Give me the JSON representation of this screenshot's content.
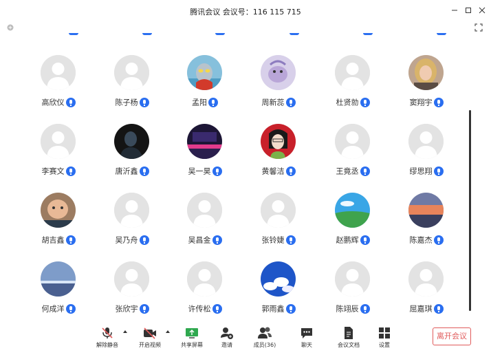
{
  "window": {
    "title": "腾讯会议 会议号：116 115 715"
  },
  "participants": [
    [
      {
        "name": "高欣仪",
        "avatar": "default"
      },
      {
        "name": "陈子杨",
        "avatar": "default"
      },
      {
        "name": "孟阳",
        "avatar": "robot"
      },
      {
        "name": "周新蕊",
        "avatar": "cartoon-purple"
      },
      {
        "name": "杜贤勍",
        "avatar": "default"
      },
      {
        "name": "窦翔宇",
        "avatar": "photo-blonde"
      }
    ],
    [
      {
        "name": "李赛文",
        "avatar": "default"
      },
      {
        "name": "唐沂鑫",
        "avatar": "dark-photo"
      },
      {
        "name": "吴一昊",
        "avatar": "neon-room"
      },
      {
        "name": "黄馨洁",
        "avatar": "cartoon-red"
      },
      {
        "name": "王竟丞",
        "avatar": "default"
      },
      {
        "name": "缪思翔",
        "avatar": "default"
      }
    ],
    [
      {
        "name": "胡吉鑫",
        "avatar": "baby-photo"
      },
      {
        "name": "吴乃舟",
        "avatar": "default"
      },
      {
        "name": "吴昌金",
        "avatar": "default"
      },
      {
        "name": "张铃婕",
        "avatar": "default"
      },
      {
        "name": "赵鹏辉",
        "avatar": "landscape-green"
      },
      {
        "name": "陈嘉杰",
        "avatar": "sunset"
      }
    ],
    [
      {
        "name": "何成洋",
        "avatar": "lake-dusk"
      },
      {
        "name": "张欣宇",
        "avatar": "default"
      },
      {
        "name": "许传松",
        "avatar": "default"
      },
      {
        "name": "郭雨鑫",
        "avatar": "blue-clouds"
      },
      {
        "name": "陈翊辰",
        "avatar": "default"
      },
      {
        "name": "屈嘉琪",
        "avatar": "default"
      }
    ]
  ],
  "mic_icon": "mic-on-icon",
  "toolbar": {
    "unmute": "解除静音",
    "start_video": "开启视频",
    "share_screen": "共享屏幕",
    "invite": "邀请",
    "members": "成员(36)",
    "chat": "聊天",
    "docs": "会议文档",
    "settings": "设置",
    "leave": "离开会议"
  },
  "colors": {
    "accent": "#2a6ef0",
    "leave": "#e05a5a",
    "share": "#2fa84f"
  }
}
